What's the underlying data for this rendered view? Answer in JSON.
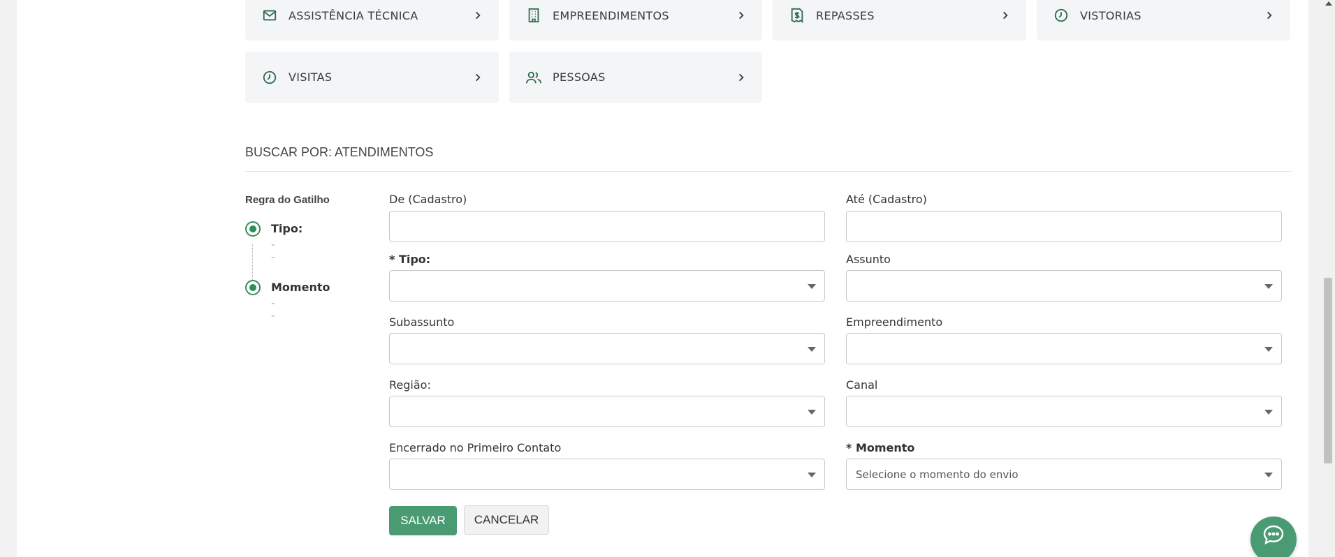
{
  "categories": [
    {
      "label": "ASSISTÊNCIA TÉCNICA",
      "icon": "mail-icon"
    },
    {
      "label": "EMPREENDIMENTOS",
      "icon": "building-icon"
    },
    {
      "label": "REPASSES",
      "icon": "receipt-dollar-icon"
    },
    {
      "label": "VISTORIAS",
      "icon": "clock-icon"
    },
    {
      "label": "VISITAS",
      "icon": "clock-icon"
    },
    {
      "label": "PESSOAS",
      "icon": "users-icon"
    }
  ],
  "search": {
    "title": "BUSCAR POR: ATENDIMENTOS"
  },
  "rule": {
    "title": "Regra do Gatilho",
    "steps": [
      {
        "name": "Tipo:",
        "value": "--"
      },
      {
        "name": "Momento",
        "value": "--"
      }
    ]
  },
  "form": {
    "de_cadastro": {
      "label": "De (Cadastro)",
      "value": ""
    },
    "ate_cadastro": {
      "label": "Até (Cadastro)",
      "value": ""
    },
    "tipo": {
      "label": "* Tipo:",
      "value": ""
    },
    "assunto": {
      "label": "Assunto",
      "value": ""
    },
    "subassunto": {
      "label": "Subassunto",
      "value": ""
    },
    "empreendimento": {
      "label": "Empreendimento",
      "value": ""
    },
    "regiao": {
      "label": "Região:",
      "value": ""
    },
    "canal": {
      "label": "Canal",
      "value": ""
    },
    "encerrado": {
      "label": "Encerrado no Primeiro Contato",
      "value": ""
    },
    "momento": {
      "label": "* Momento",
      "value": "Selecione o momento do envio"
    }
  },
  "actions": {
    "save": "SALVAR",
    "cancel": "CANCELAR"
  },
  "colors": {
    "accent": "#4a9b73",
    "icon": "#2f6b50",
    "card_bg": "#f4f5f7"
  }
}
